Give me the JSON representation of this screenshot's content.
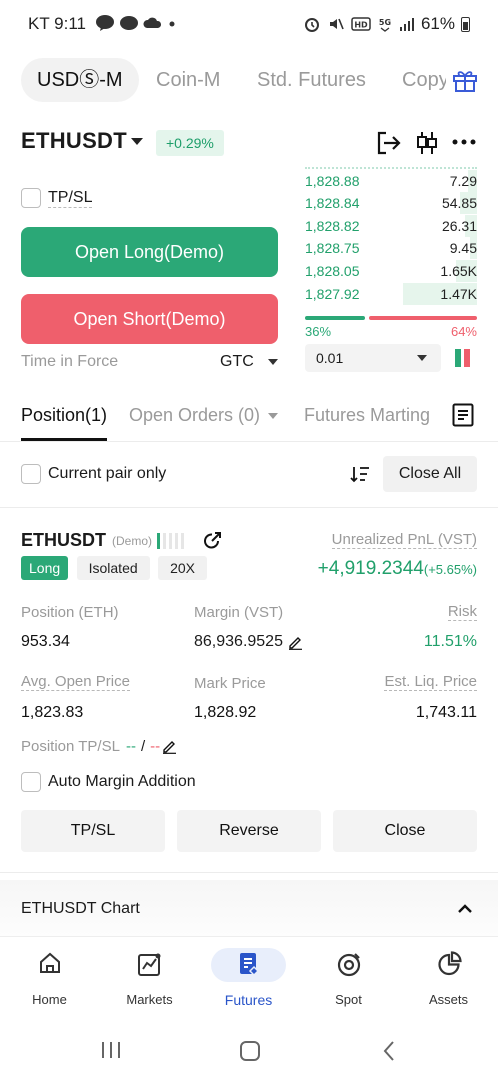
{
  "status_bar": {
    "time": "KT 9:11",
    "battery": "61%"
  },
  "top_tabs": [
    "USDⓈ-M",
    "Coin-M",
    "Std. Futures",
    "Copy"
  ],
  "symbol": {
    "name": "ETHUSDT",
    "change": "+0.29%"
  },
  "trade_form": {
    "tpsl_label": "TP/SL",
    "open_long": "Open Long(Demo)",
    "open_short": "Open Short(Demo)",
    "time_in_force_label": "Time in Force",
    "time_in_force_value": "GTC"
  },
  "order_book": {
    "rows": [
      {
        "price": "1,828.88",
        "qty": "7.29",
        "depth": 0.05
      },
      {
        "price": "1,828.84",
        "qty": "54.85",
        "depth": 0.1
      },
      {
        "price": "1,828.82",
        "qty": "26.31",
        "depth": 0.07
      },
      {
        "price": "1,828.75",
        "qty": "9.45",
        "depth": 0.04
      },
      {
        "price": "1,828.05",
        "qty": "1.65K",
        "depth": 0.12
      },
      {
        "price": "1,827.92",
        "qty": "1.47K",
        "depth": 0.43
      }
    ],
    "buy_ratio": "36%",
    "sell_ratio": "64%",
    "buy_fraction": 0.36,
    "precision": "0.01"
  },
  "section_tabs": {
    "position": "Position(1)",
    "open_orders": "Open Orders (0)",
    "futures_martingale": "Futures Marting"
  },
  "filters": {
    "current_pair_only": "Current pair only",
    "close_all": "Close All"
  },
  "position": {
    "symbol": "ETHUSDT",
    "demo_tag": "(Demo)",
    "side": "Long",
    "margin_mode": "Isolated",
    "leverage": "20X",
    "unrealized_pnl_label": "Unrealized PnL (VST)",
    "unrealized_pnl_value": "+4,919.2344",
    "unrealized_pnl_pct": "(+5.65%)",
    "position_label": "Position (ETH)",
    "position_value": "953.34",
    "margin_label": "Margin (VST)",
    "margin_value": "86,936.9525",
    "risk_label": "Risk",
    "risk_value": "11.51%",
    "avg_open_label": "Avg. Open Price",
    "avg_open_value": "1,823.83",
    "mark_label": "Mark Price",
    "mark_value": "1,828.92",
    "liq_label": "Est. Liq. Price",
    "liq_value": "1,743.11",
    "tpsl_label": "Position TP/SL",
    "tp_value": "--",
    "sep": "/",
    "sl_value": "--",
    "auto_margin": "Auto Margin Addition",
    "btn_tpsl": "TP/SL",
    "btn_reverse": "Reverse",
    "btn_close": "Close"
  },
  "chart_section": {
    "title": "ETHUSDT Chart"
  },
  "bottom_nav": [
    "Home",
    "Markets",
    "Futures",
    "Spot",
    "Assets"
  ],
  "colors": {
    "green": "#2ba877",
    "red": "#ef5f6c",
    "active_nav": "#2a55c9"
  }
}
